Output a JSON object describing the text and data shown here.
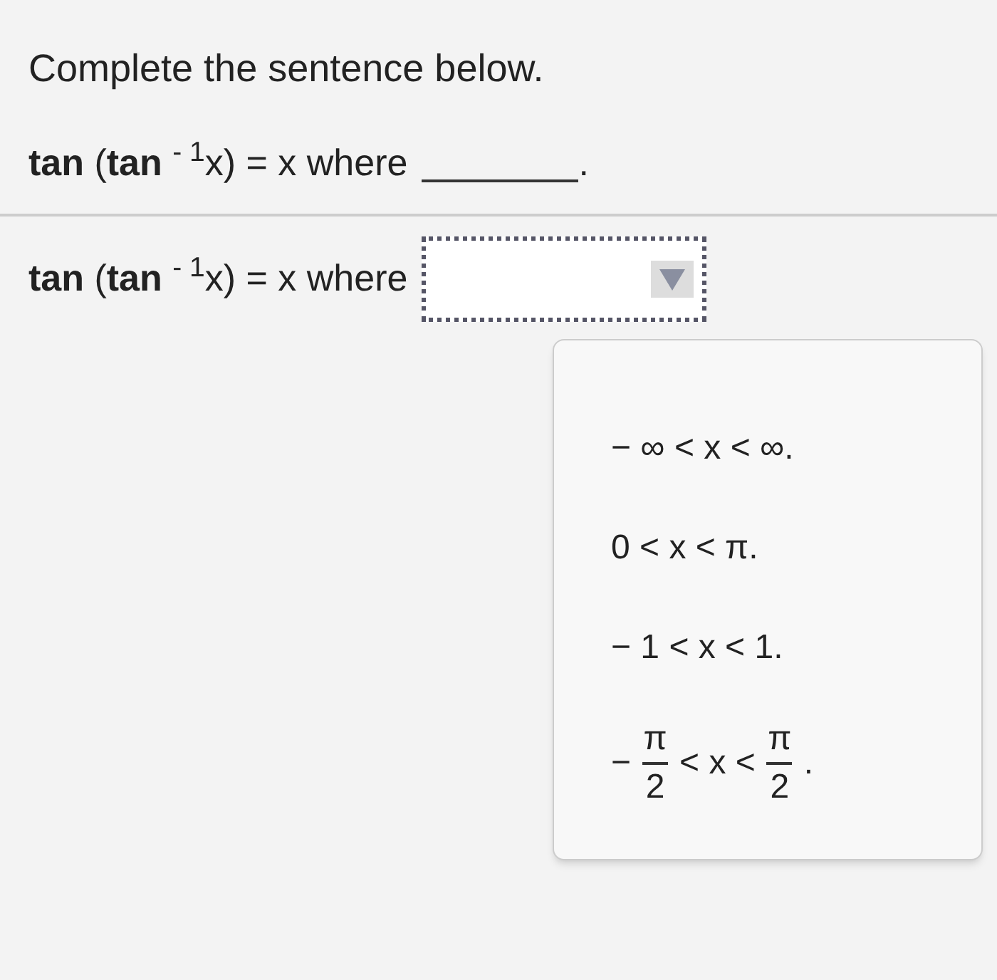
{
  "instruction": "Complete the sentence below.",
  "sentence": {
    "expression": "**tan** (**tan** $^{- 1}$x) = x where",
    "blank_end": "."
  },
  "answer": {
    "expression": "**tan** (**tan** $^{- 1}$x) = x where",
    "dropdown": {
      "expanded": true,
      "options": [
        {
          "kind": "text",
          "text": "− ∞ < x < ∞."
        },
        {
          "kind": "text",
          "text": "0 < x < π."
        },
        {
          "kind": "text",
          "text": "− 1 < x < 1."
        },
        {
          "kind": "fraction",
          "prefix": "−",
          "left_num": "π",
          "left_den": "2",
          "middle": "< x <",
          "right_num": "π",
          "right_den": "2",
          "suffix": "."
        }
      ]
    }
  }
}
